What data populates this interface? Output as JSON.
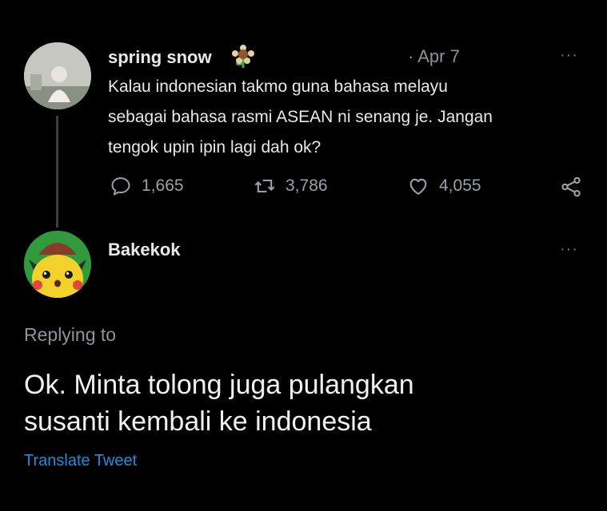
{
  "original_tweet": {
    "author_name": "spring snow",
    "date": "· Apr 7",
    "text_lines": [
      "Kalau indonesian takmo guna bahasa melayu",
      "sebagai bahasa rasmi ASEAN ni senang je. Jangan",
      "tengok upin ipin lagi dah ok?"
    ],
    "more_label": "···",
    "stats": {
      "replies": "1,665",
      "retweets": "3,786",
      "likes": "4,055"
    }
  },
  "reply_tweet": {
    "author_name": "Bakekok",
    "more_label": "···",
    "replying_to_label": "Replying to",
    "text_lines": [
      "Ok. Minta tolong juga pulangkan",
      "susanti kembali ke indonesia"
    ],
    "translate_label": "Translate Tweet"
  },
  "colors": {
    "background": "#000000",
    "text": "#e7e9ea",
    "muted": "#8b949a",
    "link": "#1d8fde",
    "pikachu_yellow": "#f4d12a"
  },
  "icons": [
    "flower-emoji-icon",
    "reply-icon",
    "retweet-icon",
    "like-icon",
    "share-icon",
    "more-icon"
  ]
}
